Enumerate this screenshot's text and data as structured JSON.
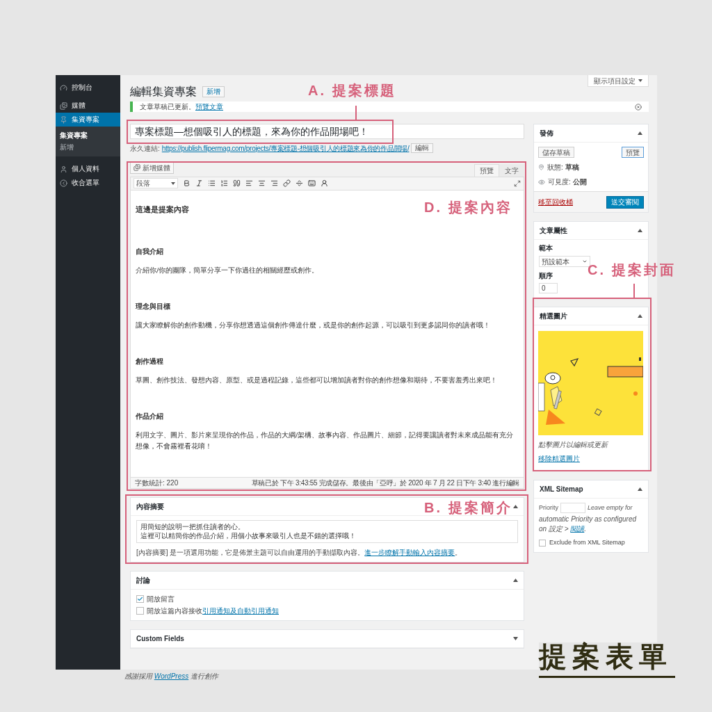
{
  "sidebar": {
    "items": [
      {
        "kind": "dashboard",
        "label": "控制台",
        "selected": false
      },
      {
        "kind": "media",
        "label": "媒體",
        "selected": false
      },
      {
        "kind": "pin",
        "label": "集資專案",
        "selected": true,
        "children": [
          {
            "label": "集資專案",
            "selected": true
          },
          {
            "label": "新增",
            "selected": false
          }
        ]
      },
      {
        "kind": "user",
        "label": "個人資料",
        "selected": false
      },
      {
        "kind": "collapse",
        "label": "收合選單",
        "selected": false
      }
    ]
  },
  "header": {
    "title": "編輯集資專案",
    "add_button": "新增",
    "screen_options": "顯示項目設定"
  },
  "notice": {
    "text": "文章草稿已更新。",
    "link": "預覽文章"
  },
  "post_title": "專案標題—想個吸引人的標題，來為你的作品開場吧！",
  "permalink": {
    "label": "永久連結:",
    "url": "https://publish.flipermag.com/projects/專案標題-想個吸引人的標題來為你的作品開場/",
    "edit_button": "編輯"
  },
  "editor": {
    "add_media": "新增媒體",
    "tabs": [
      {
        "label": "預覽",
        "selected": true
      },
      {
        "label": "文字",
        "selected": false
      }
    ],
    "format_select": "段落",
    "content": [
      {
        "kind": "lead",
        "text": "這邊是提案內容"
      },
      {
        "kind": "heading",
        "text": "自我介紹"
      },
      {
        "kind": "paragraph",
        "text": "介紹你/你的團隊，簡單分享一下你過往的相關經歷或創作。"
      },
      {
        "kind": "heading",
        "text": "理念與目標"
      },
      {
        "kind": "paragraph",
        "text": "讓大家瞭解你的創作動機，分享你想透過這個創作傳達什麼，或是你的創作起源，可以吸引到更多認同你的讀者哦！"
      },
      {
        "kind": "heading",
        "text": "創作過程"
      },
      {
        "kind": "paragraph",
        "text": "草圖、創作技法、發想內容、原型、或是過程記錄，這些都可以增加讀者對你的創作想像和期待，不要害羞秀出來吧！"
      },
      {
        "kind": "heading",
        "text": "作品介紹"
      },
      {
        "kind": "paragraph",
        "text": "利用文字、圖片、影片來呈現你的作品，作品的大綱/架構、故事內容、作品圖片、細節，記得要讓讀者對未來成品能有充分想像，不會霧裡看花唷！"
      }
    ],
    "word_count": "字數統計: 220",
    "status": "草稿已於 下午 3:43:55 完成儲存。最後由「亞呼」於 2020 年 7 月 22 日下午 3:40 進行編輯"
  },
  "excerpt": {
    "title": "內容摘要",
    "value_lines": [
      "用簡短的說明一把抓住讀者的心。",
      "這裡可以精簡你的作品介紹，用個小故事來吸引人也是不錯的選擇哦！"
    ],
    "help": "[內容摘要] 是一項選用功能，它是佈景主題可以自由運用的手動擷取內容。",
    "help_link": "進一步瞭解手動輸入內容摘要",
    "help_end": "。"
  },
  "discussion": {
    "title": "討論",
    "expanded": true,
    "options": [
      {
        "label": "開放留言",
        "checked": true
      },
      {
        "label": "開放這篇內容接收",
        "link": "引用通知及自動引用通知",
        "checked": false
      }
    ]
  },
  "custom_fields": {
    "title": "Custom Fields",
    "expanded": false
  },
  "publish": {
    "title": "發佈",
    "expanded": true,
    "save_draft": "儲存草稿",
    "preview": "預覽",
    "status_label": "狀態:",
    "status": "草稿",
    "visibility_label": "可見度:",
    "visibility": "公開",
    "trash": "移至回收桶",
    "submit": "送交審閱"
  },
  "attributes": {
    "title": "文章屬性",
    "expanded": true,
    "template_label": "範本",
    "template": "預設範本",
    "order_label": "順序",
    "order": "0"
  },
  "featured": {
    "title": "精選圖片",
    "expanded": true,
    "hint": "點擊圖片以編輯或更新",
    "remove": "移除精選圖片"
  },
  "sitemap": {
    "title": "XML Sitemap",
    "expanded": true,
    "priority_label": "Priority",
    "note": "Leave empty for",
    "note_2": "automatic Priority as configured on 設定 > ",
    "note_link": "閱讀",
    "note_end": ".",
    "exclude": {
      "label": "Exclude from XML Sitemap",
      "checked": false
    }
  },
  "footer": {
    "text": "感謝採用 ",
    "link": "WordPress",
    "text_end": " 進行創作"
  },
  "annotations": [
    {
      "kind": "title",
      "label": "A. 提案標題"
    },
    {
      "kind": "content",
      "label": "D. 提案內容"
    },
    {
      "kind": "cover",
      "label": "C. 提案封面"
    },
    {
      "kind": "excerpt",
      "label": "B. 提案簡介"
    }
  ],
  "caption": "提案表單"
}
